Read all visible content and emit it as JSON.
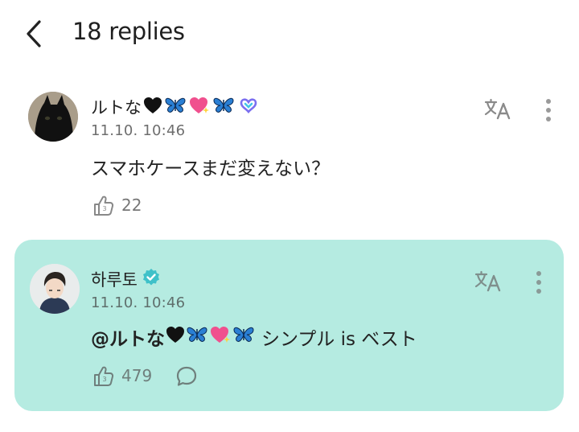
{
  "header": {
    "title": "18 replies"
  },
  "comments": [
    {
      "author": "ルトな",
      "author_emojis": [
        "black-heart",
        "butterfly",
        "sparkling-heart",
        "butterfly"
      ],
      "timestamp": "11.10. 10:46",
      "text": "スマホケースまだ変えない？",
      "likes": "22"
    },
    {
      "author": "하루토",
      "verified": true,
      "timestamp": "11.10. 10:46",
      "mention": "@ルトな",
      "mention_emojis": [
        "black-heart",
        "butterfly",
        "sparkling-heart",
        "butterfly"
      ],
      "text": "シンプル is ベスト",
      "likes": "479"
    }
  ],
  "colors": {
    "highlight_bg": "#b5ebe1",
    "verified_badge": "#3fc1c9",
    "weverse_badge": "#7b6ff0"
  }
}
